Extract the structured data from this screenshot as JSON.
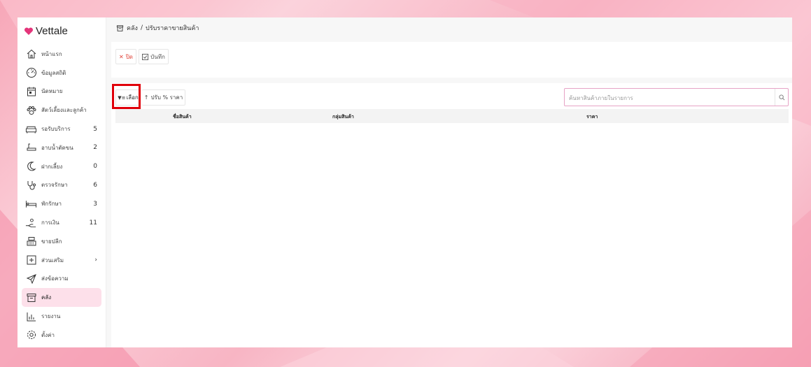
{
  "app": {
    "name": "Vettale",
    "brand_color": "#e4357a"
  },
  "breadcrumb": {
    "root": "คลัง",
    "separator": "/",
    "current": "ปรับราคาขายสินค้า"
  },
  "toolbar": {
    "close_label": "ปิด",
    "save_label": "บันทึก"
  },
  "filters": {
    "select_label": "เลือก",
    "adjust_label": "ปรับ % ราคา"
  },
  "search": {
    "placeholder": "ค้นหาสินค้าภายในรายการ"
  },
  "table": {
    "columns": [
      "ชื่อสินค้า",
      "กลุ่มสินค้า",
      "ราคา"
    ]
  },
  "sidebar": {
    "items": [
      {
        "label": "หน้าแรก",
        "icon": "home-icon",
        "count": ""
      },
      {
        "label": "ข้อมูลสถิติ",
        "icon": "dashboard-icon",
        "count": ""
      },
      {
        "label": "นัดหมาย",
        "icon": "calendar-icon",
        "count": ""
      },
      {
        "label": "สัตว์เลี้ยงและลูกค้า",
        "icon": "paw-icon",
        "count": ""
      },
      {
        "label": "รอรับบริการ",
        "icon": "sofa-icon",
        "count": "5"
      },
      {
        "label": "อาบน้ำตัดขน",
        "icon": "bath-icon",
        "count": "2"
      },
      {
        "label": "ฝากเลี้ยง",
        "icon": "moon-icon",
        "count": "0"
      },
      {
        "label": "ตรวจรักษา",
        "icon": "stethoscope-icon",
        "count": "6"
      },
      {
        "label": "พักรักษา",
        "icon": "bed-icon",
        "count": "3"
      },
      {
        "label": "การเงิน",
        "icon": "money-hand-icon",
        "count": "11"
      },
      {
        "label": "ขายปลีก",
        "icon": "cash-register-icon",
        "count": ""
      },
      {
        "label": "ส่วนเสริม",
        "icon": "plus-square-icon",
        "count": "›"
      },
      {
        "label": "ส่งข้อความ",
        "icon": "send-icon",
        "count": ""
      },
      {
        "label": "คลัง",
        "icon": "archive-icon",
        "count": "",
        "active": true
      },
      {
        "label": "รายงาน",
        "icon": "bar-chart-icon",
        "count": ""
      },
      {
        "label": "ตั้งค่า",
        "icon": "gear-icon",
        "count": ""
      }
    ]
  }
}
